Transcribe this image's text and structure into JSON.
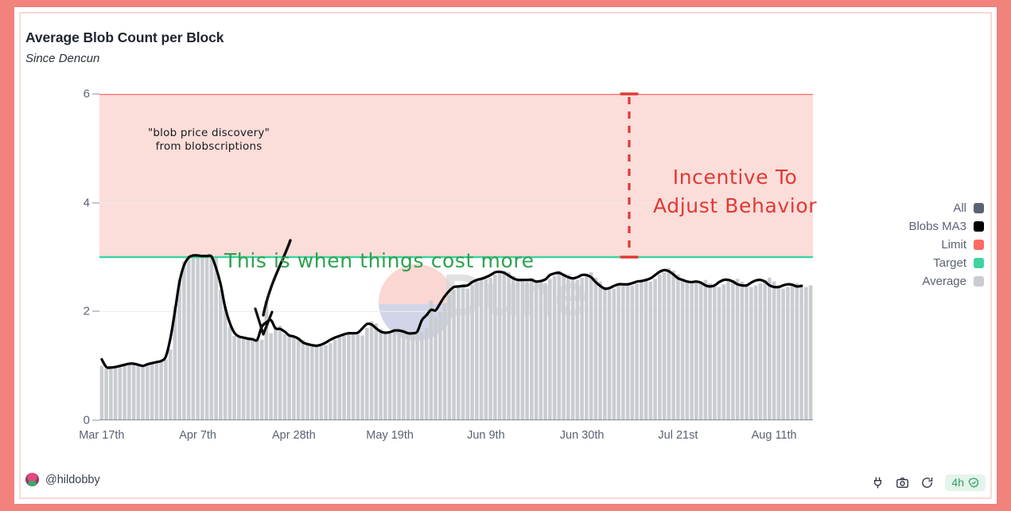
{
  "header": {
    "title": "Average Blob Count per Block",
    "subtitle": "Since Dencun"
  },
  "colors": {
    "all": "#5B6271",
    "blobs_ma3": "#000000",
    "limit": "#FB6B63",
    "target": "#3FD3A0",
    "average": "#C9CCD1",
    "band_fill": "#FBDDDA",
    "frame": "#F1827C",
    "annotation_green": "#2FA14F",
    "annotation_red": "#E03A34"
  },
  "legend": {
    "items": [
      {
        "label": "All",
        "color": "#5B6271",
        "key": "all"
      },
      {
        "label": "Blobs MA3",
        "color": "#000000",
        "key": "blobs-ma3"
      },
      {
        "label": "Limit",
        "color": "#FB6B63",
        "key": "limit"
      },
      {
        "label": "Target",
        "color": "#3FD3A0",
        "key": "target"
      },
      {
        "label": "Average",
        "color": "#C9CCD1",
        "key": "average"
      }
    ]
  },
  "annotations": {
    "blob_discovery": "\"blob price discovery\"\nfrom blobscriptions",
    "blob_discovery_line1": "\"blob price discovery\"",
    "blob_discovery_line2": "from blobscriptions",
    "cost_more": "This is when things cost more",
    "incentive_line1": "Incentive To",
    "incentive_line2": "Adjust Behavior"
  },
  "watermark": {
    "text": "Dune"
  },
  "footer": {
    "author": "@hildobby",
    "refresh_interval": "4h",
    "icons": [
      "embed-icon",
      "camera-icon",
      "refresh-icon",
      "verified-icon"
    ]
  },
  "chart_data": {
    "type": "bar",
    "title": "Average Blob Count per Block",
    "subtitle": "Since Dencun",
    "xlabel": "",
    "ylabel": "",
    "ylim": [
      0,
      6
    ],
    "yticks": [
      0,
      2,
      4,
      6
    ],
    "ytick_labels": [
      "0",
      "2",
      "4",
      "6"
    ],
    "grid": true,
    "legend_position": "right",
    "xtick_labels": [
      "Mar 17th",
      "Apr 7th",
      "Apr 28th",
      "May 19th",
      "Jun 9th",
      "Jun 30th",
      "Jul 21st",
      "Aug 11th"
    ],
    "xtick_indices": [
      0,
      21,
      42,
      63,
      84,
      105,
      126,
      147
    ],
    "reference_lines": [
      {
        "name": "Limit",
        "value": 6,
        "color": "#FB6B63"
      },
      {
        "name": "Target",
        "value": 3,
        "color": "#3FD3A0"
      }
    ],
    "shaded_band": {
      "from": 3,
      "to": 6,
      "color": "#FBDDDA"
    },
    "series": [
      {
        "name": "All",
        "type": "bar",
        "color": "#C9CCD1",
        "values": [
          1.0,
          0.95,
          0.96,
          0.99,
          1.0,
          1.02,
          1.05,
          1.05,
          1.02,
          0.99,
          1.02,
          1.08,
          1.06,
          1.08,
          1.12,
          1.3,
          2.1,
          2.6,
          2.92,
          3.02,
          3.04,
          3.02,
          3.02,
          3.02,
          3.02,
          3.0,
          2.4,
          2.1,
          1.72,
          1.55,
          1.55,
          1.52,
          1.5,
          1.5,
          1.48,
          1.48,
          2.2,
          1.6,
          1.72,
          1.74,
          1.58,
          1.56,
          1.55,
          1.52,
          1.48,
          1.42,
          1.4,
          1.38,
          1.36,
          1.38,
          1.42,
          1.48,
          1.52,
          1.55,
          1.58,
          1.62,
          1.58,
          1.56,
          1.7,
          1.82,
          1.78,
          1.68,
          1.62,
          1.6,
          1.62,
          1.65,
          1.68,
          1.62,
          1.6,
          1.58,
          1.62,
          1.7,
          2.2,
          1.9,
          2.0,
          2.15,
          2.3,
          2.4,
          2.45,
          2.5,
          2.42,
          2.48,
          2.55,
          2.58,
          2.6,
          2.62,
          2.68,
          2.72,
          2.75,
          2.72,
          2.65,
          2.6,
          2.58,
          2.55,
          2.62,
          2.58,
          2.55,
          2.52,
          2.6,
          2.65,
          2.75,
          2.7,
          2.68,
          2.62,
          2.58,
          2.62,
          2.68,
          2.72,
          2.62,
          2.55,
          2.45,
          2.4,
          2.42,
          2.48,
          2.52,
          2.5,
          2.48,
          2.52,
          2.55,
          2.58,
          2.55,
          2.6,
          2.68,
          2.72,
          2.8,
          2.75,
          2.68,
          2.6,
          2.58,
          2.55,
          2.52,
          2.55,
          2.58,
          2.52,
          2.48,
          2.45,
          2.5,
          2.55,
          2.58,
          2.6,
          2.55,
          2.5,
          2.45,
          2.48,
          2.52,
          2.58,
          2.62,
          2.55,
          2.48,
          2.42,
          2.45,
          2.48,
          2.52,
          2.5,
          2.45,
          2.48
        ]
      },
      {
        "name": "Blobs MA3",
        "type": "line",
        "color": "#000000",
        "values": [
          1.12,
          0.98,
          0.97,
          0.98,
          1.0,
          1.02,
          1.04,
          1.04,
          1.02,
          1.0,
          1.03,
          1.05,
          1.07,
          1.09,
          1.17,
          1.5,
          2.0,
          2.54,
          2.85,
          2.99,
          3.03,
          3.03,
          3.02,
          3.02,
          3.01,
          2.8,
          2.5,
          2.07,
          1.79,
          1.61,
          1.54,
          1.52,
          1.5,
          1.49,
          1.48,
          1.72,
          1.8,
          1.84,
          1.69,
          1.68,
          1.63,
          1.56,
          1.54,
          1.5,
          1.43,
          1.4,
          1.38,
          1.37,
          1.39,
          1.43,
          1.48,
          1.52,
          1.55,
          1.58,
          1.6,
          1.6,
          1.61,
          1.69,
          1.77,
          1.76,
          1.69,
          1.63,
          1.61,
          1.62,
          1.65,
          1.65,
          1.63,
          1.6,
          1.6,
          1.63,
          1.84,
          1.93,
          2.03,
          2.02,
          2.15,
          2.28,
          2.38,
          2.45,
          2.46,
          2.47,
          2.48,
          2.54,
          2.58,
          2.6,
          2.63,
          2.67,
          2.72,
          2.73,
          2.71,
          2.66,
          2.61,
          2.58,
          2.58,
          2.58,
          2.58,
          2.55,
          2.56,
          2.59,
          2.67,
          2.7,
          2.71,
          2.67,
          2.63,
          2.61,
          2.63,
          2.67,
          2.67,
          2.63,
          2.54,
          2.47,
          2.42,
          2.43,
          2.47,
          2.5,
          2.5,
          2.5,
          2.52,
          2.55,
          2.56,
          2.58,
          2.61,
          2.67,
          2.73,
          2.76,
          2.74,
          2.68,
          2.61,
          2.58,
          2.55,
          2.54,
          2.55,
          2.53,
          2.48,
          2.46,
          2.48,
          2.54,
          2.58,
          2.58,
          2.55,
          2.5,
          2.48,
          2.48,
          2.53,
          2.57,
          2.58,
          2.55,
          2.48,
          2.45,
          2.45,
          2.48,
          2.5,
          2.49,
          2.46,
          2.47
        ]
      }
    ]
  }
}
